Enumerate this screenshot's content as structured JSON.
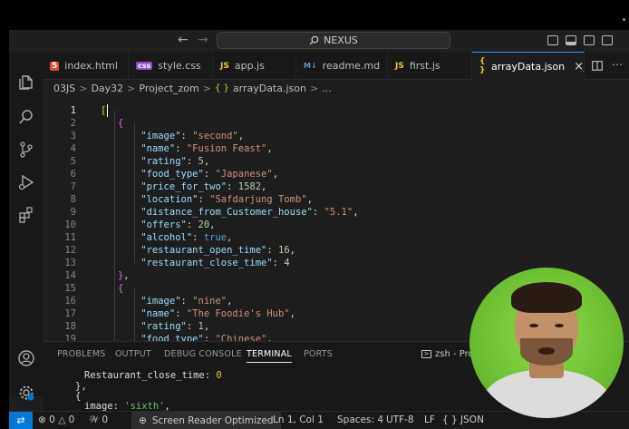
{
  "titlebar": {
    "search_text": "NEXUS"
  },
  "tabs": [
    {
      "label": "index.html",
      "icon": "html-file-icon"
    },
    {
      "label": "style.css",
      "icon": "css-file-icon"
    },
    {
      "label": "app.js",
      "icon": "js-file-icon"
    },
    {
      "label": "readme.md",
      "icon": "markdown-file-icon"
    },
    {
      "label": "first.js",
      "icon": "js-file-icon"
    },
    {
      "label": "arrayData.json",
      "icon": "json-file-icon",
      "active": true
    }
  ],
  "icons": {
    "html": "5",
    "css": "css",
    "js": "JS",
    "md": "M↓",
    "json": "{ }"
  },
  "breadcrumb": {
    "parts": [
      "03JS",
      "Day32",
      "Project_zom",
      "arrayData.json",
      "..."
    ],
    "separator": ">"
  },
  "editor": {
    "line_numbers": [
      "1",
      "2",
      "3",
      "4",
      "5",
      "6",
      "7",
      "8",
      "9",
      "10",
      "11",
      "12",
      "13",
      "14",
      "15",
      "16",
      "17",
      "18",
      "19"
    ]
  },
  "panel": {
    "tabs": [
      "PROBLEMS",
      "OUTPUT",
      "DEBUG CONSOLE",
      "TERMINAL",
      "PORTS"
    ],
    "active_tab": "TERMINAL",
    "terminal_label": "zsh - Project"
  },
  "statusbar": {
    "errors": "0",
    "warnings": "0",
    "ports": "0",
    "screen_reader": "Screen Reader Optimized",
    "position": "Ln 1, Col 1",
    "spaces": "Spaces: 4",
    "encoding": "UTF-8",
    "eol": "LF",
    "language": "JSON"
  },
  "colors": {
    "accent": "#0078d4",
    "editor_bg": "#1e1e1e",
    "key": "#9cdcfe",
    "string": "#ce9178",
    "number": "#b5cea8",
    "boolean": "#569cd6"
  }
}
